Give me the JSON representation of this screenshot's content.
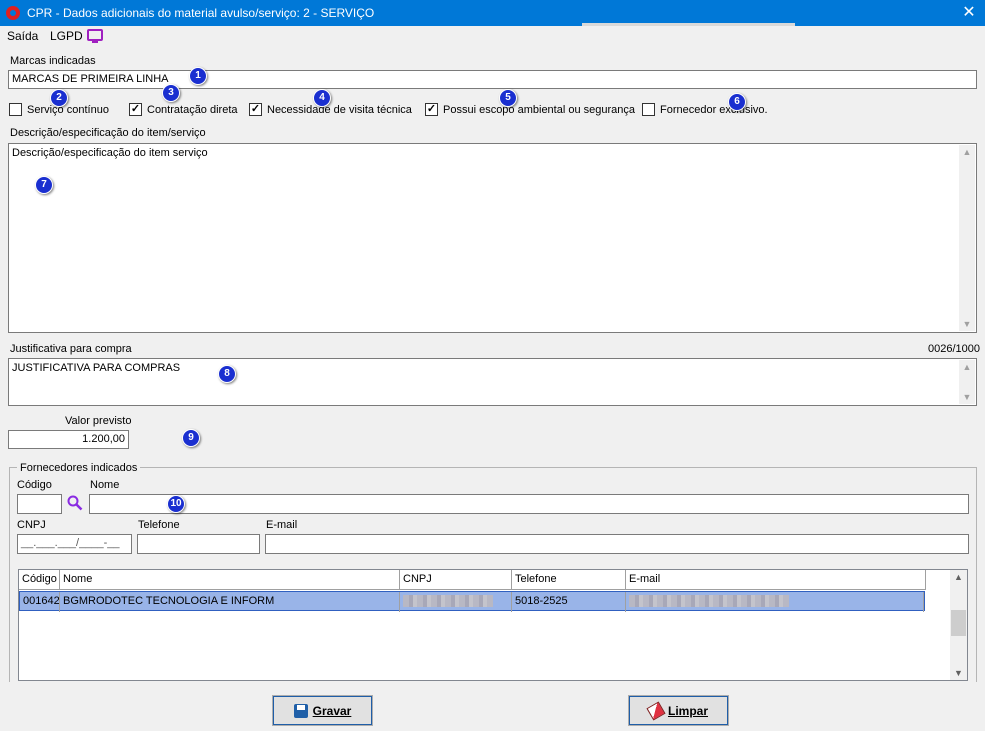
{
  "window": {
    "title": "CPR - Dados adicionais do material avulso/serviço: 2 - SERVIÇO",
    "close": "✕"
  },
  "menu": {
    "saida": "Saída",
    "lgpd": "LGPD"
  },
  "marcas": {
    "label": "Marcas indicadas",
    "value": "MARCAS DE PRIMEIRA LINHA"
  },
  "checkboxes": [
    {
      "label": "Serviço contínuo",
      "checked": false
    },
    {
      "label": "Contratação direta",
      "checked": true
    },
    {
      "label": "Necessidade de visita técnica",
      "checked": true
    },
    {
      "label": "Possui escopo ambiental ou segurança",
      "checked": true
    },
    {
      "label": "Fornecedor exclusivo.",
      "checked": false
    }
  ],
  "descricao": {
    "label": "Descrição/especificação do item/serviço",
    "value": "Descrição/especificação do item serviço"
  },
  "justificativa": {
    "label": "Justificativa para compra",
    "counter": "0026/1000",
    "value": "JUSTIFICATIVA PARA COMPRAS"
  },
  "valor": {
    "label": "Valor previsto",
    "value": "1.200,00"
  },
  "fornecedores": {
    "group_title": "Fornecedores indicados",
    "codigo_label": "Código",
    "nome_label": "Nome",
    "cnpj_label": "CNPJ",
    "cnpj_mask": "__.___.___/____-__",
    "telefone_label": "Telefone",
    "email_label": "E-mail",
    "grid": {
      "columns": [
        "Código",
        "Nome",
        "CNPJ",
        "Telefone",
        "E-mail"
      ],
      "rows": [
        {
          "codigo": "001642",
          "nome": "BGMRODOTEC TECNOLOGIA E INFORM",
          "telefone": "5018-2525"
        }
      ]
    }
  },
  "buttons": {
    "gravar": "Gravar",
    "limpar": "Limpar"
  },
  "badges": [
    "1",
    "2",
    "3",
    "4",
    "5",
    "6",
    "7",
    "8",
    "9",
    "10"
  ],
  "colors": {
    "titlebar": "#0078d7",
    "badge": "#1a2fd0",
    "selection": "#99b4e8"
  }
}
